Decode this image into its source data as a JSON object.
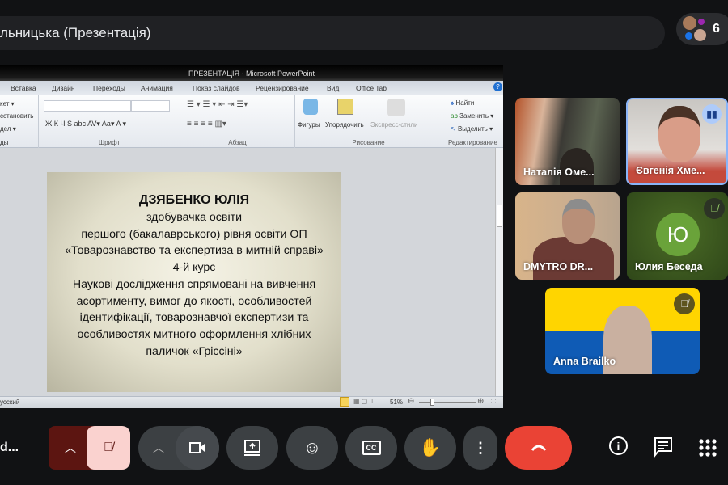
{
  "meeting": {
    "title": "льницька (Презентація)",
    "participant_count": "6",
    "self_name_truncated": "d..."
  },
  "ppt": {
    "window_title": "ПРЕЗЕНТАЦІЯ  -  Microsoft PowerPoint",
    "tabs": [
      "Вставка",
      "Дизайн",
      "Переходы",
      "Анимация",
      "Показ слайдов",
      "Рецензирование",
      "Вид",
      "Office Tab"
    ],
    "clipboard": [
      "кет ▾",
      "сстановить",
      "дел ▾",
      "ды"
    ],
    "groups": {
      "font": "Шрифт",
      "paragraph": "Абзац",
      "drawing": "Рисование",
      "editing": "Редактирование"
    },
    "font_buttons": "Ж  К  Ч  S  abc  AV▾  Aa▾    A ▾",
    "drawing": {
      "shapes": "Фигуры",
      "arrange": "Упорядочить",
      "quick_styles": "Экспресс-стили"
    },
    "editing": {
      "find": "Найти",
      "replace": "Заменить ▾",
      "select": "Выделить ▾"
    },
    "status": {
      "language": "усский",
      "zoom": "51%"
    },
    "slide": {
      "name": "ДЗЯБЕНКО ЮЛІЯ",
      "lines": [
        "здобувачка освіти",
        "першого (бакалаврського) рівня освіти ОП",
        "«Товарознавство та експертиза в митній справі»",
        "4-й курс",
        "Наукові дослідження спрямовані на вивчення",
        "асортименту, вимог до якості,  особливостей",
        "ідентифікації, товарознавчої експертизи та",
        "особливостях митного оформлення хлібних",
        "паличок «Гріссіні»"
      ]
    }
  },
  "participants": [
    {
      "name": "Наталія Оме...",
      "state": "video"
    },
    {
      "name": "Євгенія Хме...",
      "state": "speaking"
    },
    {
      "name": "DMYTRO DR...",
      "state": "video"
    },
    {
      "name": "Юлия Беседа",
      "initial": "Ю",
      "state": "muted",
      "color": "#6aa33a"
    },
    {
      "name": "Anna Brailko",
      "state": "muted"
    }
  ],
  "colors": {
    "end_call": "#ea4335",
    "mic_off_bg": "#fad2cf",
    "mic_chevron_bg": "#5c1511",
    "speaking_border": "#8ab4f8"
  }
}
